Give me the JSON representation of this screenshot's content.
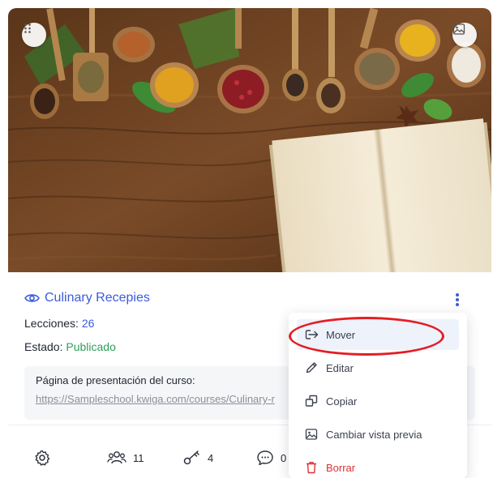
{
  "course": {
    "title": "Culinary Recepies",
    "lessons_label": "Lecciones:",
    "lessons_count": "26",
    "state_label": "Estado:",
    "state_value": "Publicado",
    "landing_label": "Página de presentación del curso:",
    "landing_url": "https://Sampleschool.kwiga.com/courses/Culinary-r"
  },
  "footer": {
    "users_count": "11",
    "keys_count": "4",
    "comments_count": "0"
  },
  "menu": {
    "items": [
      {
        "label": "Mover",
        "icon": "move-icon"
      },
      {
        "label": "Editar",
        "icon": "pencil-icon"
      },
      {
        "label": "Copiar",
        "icon": "copy-icon"
      },
      {
        "label": "Cambiar vista previa",
        "icon": "image-icon"
      },
      {
        "label": "Borrar",
        "icon": "trash-icon"
      }
    ]
  },
  "colors": {
    "accent": "#3b5bdb",
    "published": "#2e9e5b",
    "danger": "#e03131",
    "highlight": "#e31e24"
  }
}
